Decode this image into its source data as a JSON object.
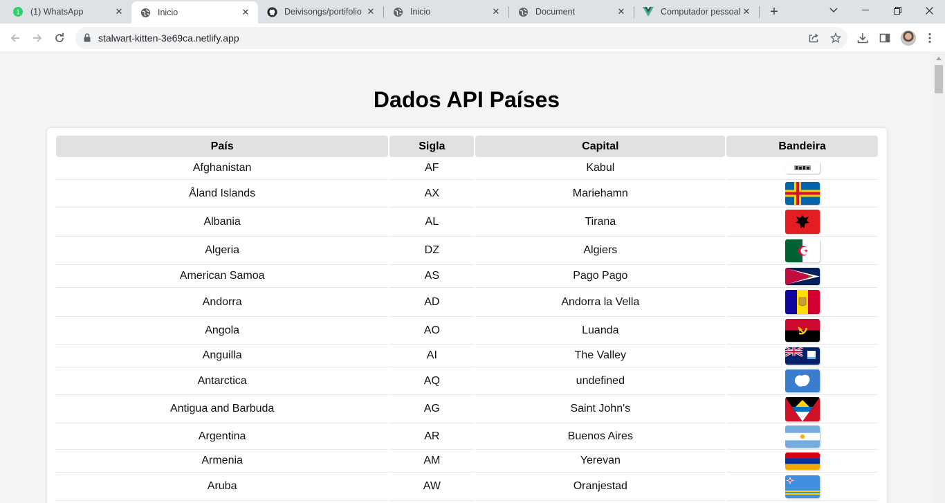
{
  "browser": {
    "tabs": [
      {
        "title": "(1) WhatsApp",
        "badge": "1",
        "icon": "whatsapp-icon",
        "active": false
      },
      {
        "title": "Inicio",
        "icon": "globe-icon",
        "active": true
      },
      {
        "title": "Deivisongs/portifolio",
        "icon": "github-icon",
        "active": false
      },
      {
        "title": "Inicio",
        "icon": "globe-icon",
        "active": false
      },
      {
        "title": "Document",
        "icon": "globe-icon",
        "active": false
      },
      {
        "title": "Computador pessoal",
        "icon": "vue-icon",
        "active": false
      }
    ],
    "address_bar": {
      "url": "stalwart-kitten-3e69ca.netlify.app"
    },
    "colors": {
      "tabstrip": "#dee1e6",
      "toolbar": "#ffffff",
      "omnibox": "#f1f3f4"
    }
  },
  "page": {
    "title": "Dados API Países",
    "table": {
      "columns": [
        "País",
        "Sigla",
        "Capital",
        "Bandeira"
      ],
      "rows": [
        {
          "country": "Afghanistan",
          "code": "AF",
          "capital": "Kabul",
          "flag": "afghanistan-flag"
        },
        {
          "country": "Åland Islands",
          "code": "AX",
          "capital": "Mariehamn",
          "flag": "aland-islands-flag"
        },
        {
          "country": "Albania",
          "code": "AL",
          "capital": "Tirana",
          "flag": "albania-flag"
        },
        {
          "country": "Algeria",
          "code": "DZ",
          "capital": "Algiers",
          "flag": "algeria-flag"
        },
        {
          "country": "American Samoa",
          "code": "AS",
          "capital": "Pago Pago",
          "flag": "american-samoa-flag"
        },
        {
          "country": "Andorra",
          "code": "AD",
          "capital": "Andorra la Vella",
          "flag": "andorra-flag"
        },
        {
          "country": "Angola",
          "code": "AO",
          "capital": "Luanda",
          "flag": "angola-flag"
        },
        {
          "country": "Anguilla",
          "code": "AI",
          "capital": "The Valley",
          "flag": "anguilla-flag"
        },
        {
          "country": "Antarctica",
          "code": "AQ",
          "capital": "undefined",
          "flag": "antarctica-flag"
        },
        {
          "country": "Antigua and Barbuda",
          "code": "AG",
          "capital": "Saint John's",
          "flag": "antigua-and-barbuda-flag"
        },
        {
          "country": "Argentina",
          "code": "AR",
          "capital": "Buenos Aires",
          "flag": "argentina-flag"
        },
        {
          "country": "Armenia",
          "code": "AM",
          "capital": "Yerevan",
          "flag": "armenia-flag"
        },
        {
          "country": "Aruba",
          "code": "AW",
          "capital": "Oranjestad",
          "flag": "aruba-flag"
        }
      ]
    }
  }
}
